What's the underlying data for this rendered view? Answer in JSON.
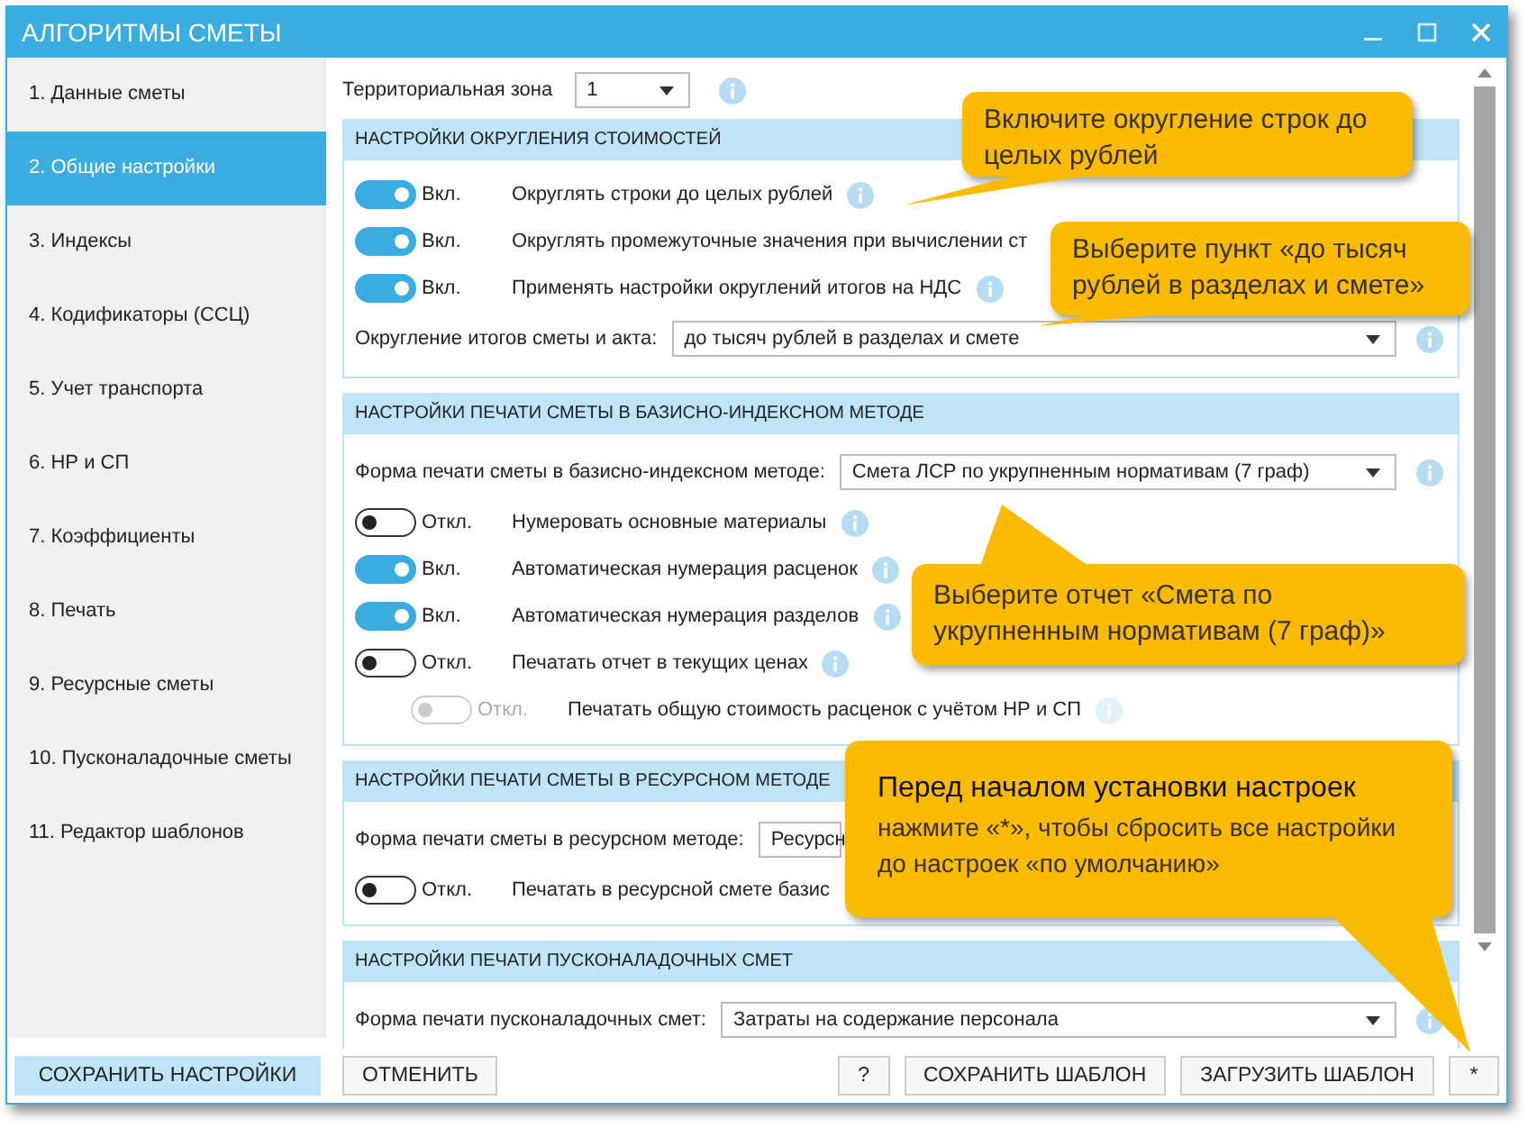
{
  "window": {
    "title": "АЛГОРИТМЫ СМЕТЫ"
  },
  "sidebar": {
    "items": [
      {
        "label": "1. Данные сметы",
        "selected": false
      },
      {
        "label": "2. Общие настройки",
        "selected": true
      },
      {
        "label": "3. Индексы",
        "selected": false
      },
      {
        "label": "4. Кодификаторы (ССЦ)",
        "selected": false
      },
      {
        "label": "5. Учет транспорта",
        "selected": false
      },
      {
        "label": "6. НР и СП",
        "selected": false
      },
      {
        "label": "7. Коэффициенты",
        "selected": false
      },
      {
        "label": "8. Печать",
        "selected": false
      },
      {
        "label": "9. Ресурсные сметы",
        "selected": false
      },
      {
        "label": "10. Пусконаладочные сметы",
        "selected": false
      },
      {
        "label": "11. Редактор шаблонов",
        "selected": false
      }
    ]
  },
  "zone": {
    "label": "Территориальная зона",
    "value": "1"
  },
  "sections": [
    {
      "title": "НАСТРОЙКИ ОКРУГЛЕНИЯ СТОИМОСТЕЙ",
      "rows": [
        {
          "kind": "toggle",
          "on": true,
          "disabled": false,
          "state": "Вкл.",
          "label": "Округлять строки до целых рублей",
          "info": true
        },
        {
          "kind": "toggle",
          "on": true,
          "disabled": false,
          "state": "Вкл.",
          "label": "Округлять промежуточные значения при вычислении ст",
          "info": false
        },
        {
          "kind": "toggle",
          "on": true,
          "disabled": false,
          "state": "Вкл.",
          "label": "Применять настройки округлений итогов на НДС",
          "info": true
        },
        {
          "kind": "select",
          "label": "Округление итогов сметы и акта:",
          "value": "до тысяч рублей в разделах и смете",
          "info": true
        }
      ]
    },
    {
      "title": "НАСТРОЙКИ ПЕЧАТИ СМЕТЫ В БАЗИСНО-ИНДЕКСНОМ МЕТОДЕ",
      "rows": [
        {
          "kind": "select",
          "label": "Форма печати сметы в базисно-индексном методе:",
          "value": "Смета ЛСР по укрупненным нормативам (7 граф)",
          "info": true
        },
        {
          "kind": "toggle",
          "on": false,
          "disabled": false,
          "state": "Откл.",
          "label": "Нумеровать основные материалы",
          "info": true
        },
        {
          "kind": "toggle",
          "on": true,
          "disabled": false,
          "state": "Вкл.",
          "label": "Автоматическая нумерация расценок",
          "info": true
        },
        {
          "kind": "toggle",
          "on": true,
          "disabled": false,
          "state": "Вкл.",
          "label": "Автоматическая нумерация разделов",
          "info": true
        },
        {
          "kind": "toggle",
          "on": false,
          "disabled": false,
          "state": "Откл.",
          "label": "Печатать отчет в текущих ценах",
          "info": true,
          "children": [
            {
              "kind": "toggle",
              "on": false,
              "disabled": true,
              "state": "Откл.",
              "label": "Печатать общую стоимость расценок с учётом НР и СП",
              "info": true
            }
          ]
        }
      ]
    },
    {
      "title": "НАСТРОЙКИ ПЕЧАТИ СМЕТЫ В РЕСУРСНОМ МЕТОДЕ",
      "rows": [
        {
          "kind": "select",
          "label": "Форма печати сметы в ресурсном методе:",
          "value": "Ресурсн",
          "info": false
        },
        {
          "kind": "toggle",
          "on": false,
          "disabled": false,
          "state": "Откл.",
          "label": "Печатать в ресурсной смете базис",
          "info": false
        }
      ]
    },
    {
      "title": "НАСТРОЙКИ ПЕЧАТИ ПУСКОНАЛАДОЧНЫХ СМЕТ",
      "rows": [
        {
          "kind": "select",
          "label": "Форма печати пусконаладочных смет:",
          "value": "Затраты на содержание персонала",
          "info": true
        }
      ]
    }
  ],
  "buttons": [
    {
      "label": "СОХРАНИТЬ НАСТРОЙКИ",
      "kind": "primary"
    },
    {
      "label": "ОТМЕНИТЬ",
      "kind": "normal"
    },
    {
      "label": "?",
      "kind": "spacer-before"
    },
    {
      "label": "СОХРАНИТЬ ШАБЛОН",
      "kind": "normal"
    },
    {
      "label": "ЗАГРУЗИТЬ ШАБЛОН",
      "kind": "normal"
    },
    {
      "label": "*",
      "kind": "small"
    }
  ],
  "callouts": [
    {
      "text": "Включите округление строк до целых рублей"
    },
    {
      "text": "Выберите пункт «до тысяч рублей в разделах и смете»"
    },
    {
      "text": "Выберите отчет «Смета по укрупненным нормативам (7 граф)»"
    },
    {
      "title": "Перед началом установки настроек",
      "text": "нажмите «*», чтобы сбросить все настройки до настроек «по умолчанию»"
    }
  ]
}
